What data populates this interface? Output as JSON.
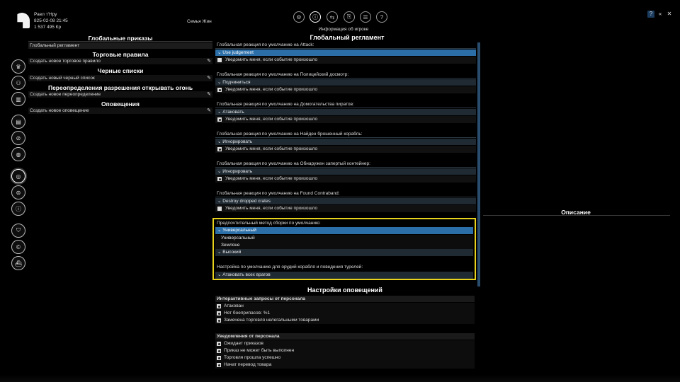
{
  "player": {
    "name": "Раел т'Нру",
    "datetime": "825-02-08 21:45",
    "money": "1 537 495 Кр"
  },
  "faction": "Семья Жин",
  "top_tabs": {
    "icons": [
      "gear-icon",
      "info-icon",
      "transfer-icon",
      "archive-icon",
      "help-icon"
    ],
    "active_label": "Информация об игроке"
  },
  "window_buttons": {
    "help": "?",
    "collapse": "«",
    "close": "✕"
  },
  "sidebar": {
    "icons": [
      "crown-icon",
      "people-icon",
      "chart-icon",
      "book-icon",
      "compass-icon",
      "globe-icon",
      "target-icon",
      "badge-icon",
      "info-icon",
      "shield-icon",
      "coin-icon",
      "ship-icon"
    ]
  },
  "left": {
    "global_orders_title": "Глобальные приказы",
    "global_orders_item": "Глобальный регламент",
    "trade_rules_title": "Торговые правила",
    "trade_rules_create": "Создать новое торговое правило",
    "blacklists_title": "Черные списки",
    "blacklists_create": "Создать новый черный список",
    "overrides_title": "Переопределения разрешения открывать огонь",
    "overrides_create": "Создать новое переопределение",
    "alerts_title": "Оповещения",
    "alerts_create": "Создать новое оповещение"
  },
  "center": {
    "title": "Глобальный регламент",
    "notify_label": "Уведомить меня, если событие произошло",
    "sections": [
      {
        "label": "Глобальная реакция по умолчанию на Attack:",
        "value": "Use judgement",
        "notify": false
      },
      {
        "label": "Глобальная реакция по умолчанию на Полицейский досмотр:",
        "value": "Подчиниться",
        "notify": true
      },
      {
        "label": "Глобальная реакция по умолчанию на Домогательства пиратов:",
        "value": "Атаковать",
        "notify": true
      },
      {
        "label": "Глобальная реакция по умолчанию на Найден брошенный корабль:",
        "value": "Игнорировать",
        "notify": true
      },
      {
        "label": "Глобальная реакция по умолчанию на Обнаружен запертый контейнер:",
        "value": "Игнорировать",
        "notify": true
      },
      {
        "label": "Глобальная реакция по умолчанию на Found Contraband:",
        "value": "Destroy dropped crates",
        "notify": false
      }
    ],
    "assembly": {
      "label": "Предпочтительный метод сборки по умолчанию:",
      "selected": "Универсальный",
      "options": [
        "Универсальный",
        "Земляне",
        "Высокий"
      ]
    },
    "turrets": {
      "label": "Настройка по умолчанию для орудий корабля и поведения турелей:",
      "value": "Атаковать всех врагов"
    }
  },
  "description_title": "Описание",
  "notifications": {
    "title": "Настройки оповещений",
    "groups": [
      {
        "title": "Интерактивные запросы от персонала",
        "items": [
          "Атакован",
          "Нет боеприпасов: %1",
          "Замечена торговля нелегальными товарами"
        ]
      },
      {
        "title": "Уведомления от персонала",
        "items": [
          "Ожидает приказов",
          "Приказ не может быть выполнен",
          "Торговля прошла успешно",
          "Начат перевод товара"
        ]
      }
    ]
  },
  "colors": {
    "accent": "#2c6fa8",
    "highlight_border": "#e8d21c",
    "panel": "#1f2a33"
  }
}
